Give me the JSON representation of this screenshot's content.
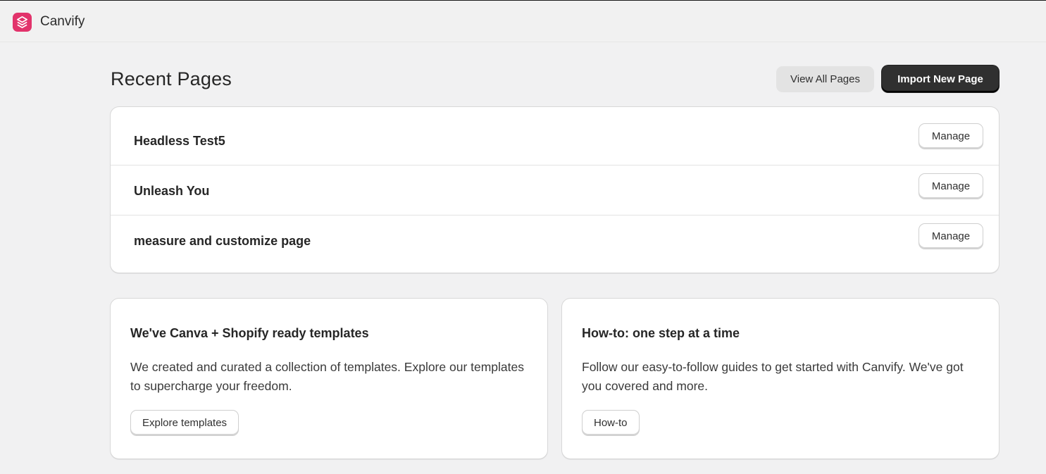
{
  "app": {
    "name": "Canvify",
    "logo_icon": "canvify-logo-icon",
    "brand_color": "#e2336b"
  },
  "header": {
    "title": "Recent Pages",
    "view_all_label": "View All Pages",
    "import_label": "Import New Page"
  },
  "pages": [
    {
      "name": "Headless Test5",
      "action": "Manage"
    },
    {
      "name": "Unleash You",
      "action": "Manage"
    },
    {
      "name": "measure and customize page",
      "action": "Manage"
    }
  ],
  "cards": {
    "templates": {
      "title": "We've Canva + Shopify ready templates",
      "body": "We created and curated a collection of templates. Explore our templates to supercharge your freedom.",
      "button": "Explore templates"
    },
    "howto": {
      "title": "How-to: one step at a time",
      "body": "Follow our easy-to-follow guides to get started with Canvify. We've got you covered and more.",
      "button": "How-to"
    }
  }
}
